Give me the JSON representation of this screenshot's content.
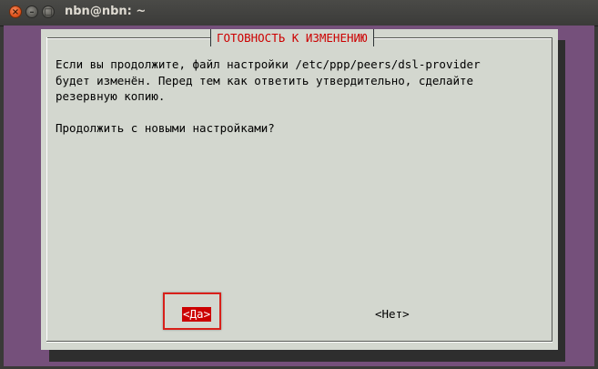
{
  "window": {
    "title": "nbn@nbn: ~",
    "close_glyph": "×",
    "min_glyph": "–",
    "max_glyph": "□"
  },
  "dialog": {
    "title": "ГОТОВНОСТЬ К ИЗМЕНЕНИЮ",
    "lines": [
      "Если вы продолжите, файл настройки /etc/ppp/peers/dsl-provider",
      "будет изменён. Перед тем как ответить утвердительно, сделайте",
      "резервную копию.",
      "",
      "Продолжить с новыми настройками?"
    ],
    "yes_label": "<Да>",
    "no_label": "<Нет>"
  },
  "colors": {
    "terminal_bg": "#75507b",
    "dialog_bg": "#d3d7cf",
    "title_color": "#cc0000",
    "selected_button_bg": "#cc0000",
    "annotation_box": "#d8201a"
  }
}
